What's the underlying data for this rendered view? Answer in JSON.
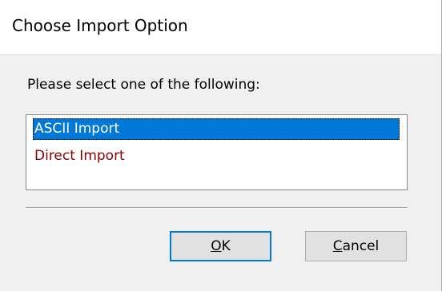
{
  "dialog": {
    "title": "Choose Import Option",
    "prompt": "Please select one of the following:",
    "options": [
      {
        "label": "ASCII Import",
        "selected": true
      },
      {
        "label": "Direct Import",
        "selected": false
      }
    ],
    "buttons": {
      "ok": {
        "mnemonic": "O",
        "rest": "K"
      },
      "cancel": {
        "mnemonic": "C",
        "rest": "ancel"
      }
    },
    "colors": {
      "selection": "#0078d7",
      "unselected_text": "#8b0000",
      "default_button_border": "#0078d7"
    }
  }
}
